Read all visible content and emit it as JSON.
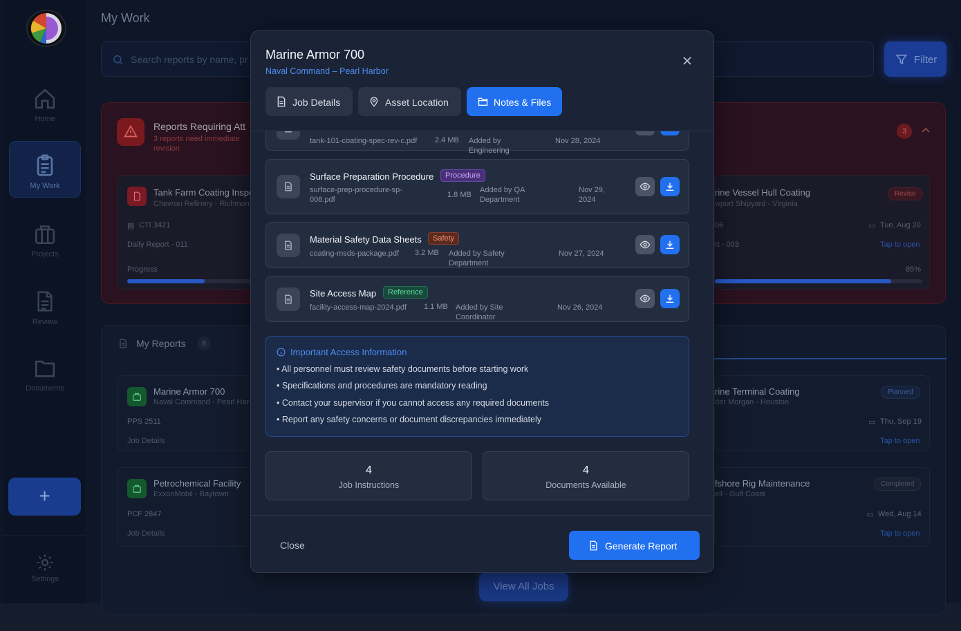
{
  "sidebar": {
    "items": [
      {
        "label": "Home",
        "icon": "home-icon"
      },
      {
        "label": "My Work",
        "icon": "clipboard-icon"
      },
      {
        "label": "Projects",
        "icon": "briefcase-icon"
      },
      {
        "label": "Review",
        "icon": "document-icon"
      },
      {
        "label": "Documents",
        "icon": "folder-icon"
      }
    ],
    "add_label": "+",
    "settings_label": "Settings"
  },
  "header": {
    "title": "My Work",
    "search_placeholder": "Search reports by name, pr",
    "filter_label": "Filter"
  },
  "requiring": {
    "title": "Reports Requiring Att",
    "subtitle": "3 reports need immediate revision",
    "count": "3",
    "cards": [
      {
        "title": "Tank Farm Coating Inspe",
        "client": "Chevron Refinery - Richmon",
        "code": "CTI 3421",
        "report": "Daily Report - 011",
        "progress_label": "Progress",
        "progress": 0.6
      },
      {
        "title": "rine Vessel Hull Coating",
        "client": "wport Shipyard - Virginia",
        "status": "Revise",
        "code": "06",
        "date": "Tue, Aug 20",
        "report": "rt - 003",
        "link": "Tap to open",
        "progress_pct": "85%",
        "progress": 0.85
      }
    ]
  },
  "my_reports": {
    "title": "My Reports",
    "count": "6",
    "left_cards": [
      {
        "title": "Marine Armor 700",
        "client": "Naval Command - Pearl Har",
        "code": "PPS 2511",
        "section": "Job Details"
      },
      {
        "title": "Petrochemical Facility",
        "client": "ExxonMobil - Baytown",
        "code": "PCF 2847",
        "section": "Job Details"
      }
    ],
    "right_cards": [
      {
        "title": "rine Terminal Coating",
        "client": "der Morgan - Houston",
        "status": "Planned",
        "date": "Thu, Sep 19",
        "link": "Tap to open"
      },
      {
        "title": "fshore Rig Maintenance",
        "client": "ell - Gulf Coast",
        "status": "Completed",
        "date": "Wed, Aug 14",
        "link": "Tap to open"
      }
    ],
    "view_all": "View All Jobs"
  },
  "modal": {
    "title": "Marine Armor 700",
    "subtitle": "Naval Command – Pearl Harbor",
    "tabs": [
      {
        "label": "Job Details",
        "icon": "document-icon"
      },
      {
        "label": "Asset Location",
        "icon": "map-pin-icon"
      },
      {
        "label": "Notes & Files",
        "icon": "folder-open-icon"
      }
    ],
    "active_tab": "Notes & Files",
    "files": [
      {
        "title": "",
        "tag": "",
        "file": "tank-101-coating-spec-rev-c.pdf",
        "size": "2.4 MB",
        "added": "Added by Engineering",
        "date": "Nov 28, 2024"
      },
      {
        "title": "Surface Preparation Procedure",
        "tag": "Procedure",
        "file": "surface-prep-procedure-sp-006.pdf",
        "size": "1.8 MB",
        "added": "Added by QA Department",
        "date": "Nov 29, 2024"
      },
      {
        "title": "Material Safety Data Sheets",
        "tag": "Safety",
        "file": "coating-msds-package.pdf",
        "size": "3.2 MB",
        "added": "Added by Safety Department",
        "date": "Nov 27, 2024"
      },
      {
        "title": "Site Access Map",
        "tag": "Reference",
        "file": "facility-access-map-2024.pdf",
        "size": "1.1 MB",
        "added": "Added by Site Coordinator",
        "date": "Nov 26, 2024"
      }
    ],
    "info": {
      "title": "Important Access Information",
      "items": [
        "• All personnel must review safety documents before starting work",
        "• Specifications and procedures are mandatory reading",
        "• Contact your supervisor if you cannot access any required documents",
        "• Report any safety concerns or document discrepancies immediately"
      ]
    },
    "stats": [
      {
        "value": "4",
        "label": "Job Instructions"
      },
      {
        "value": "4",
        "label": "Documents Available"
      }
    ],
    "close_label": "Close",
    "generate_label": "Generate Report"
  },
  "colors": {
    "accent": "#2170f0",
    "procedure": "#a878f0",
    "safety": "#e0704a",
    "reference": "#3ec28a",
    "danger": "#7a1a1f"
  }
}
